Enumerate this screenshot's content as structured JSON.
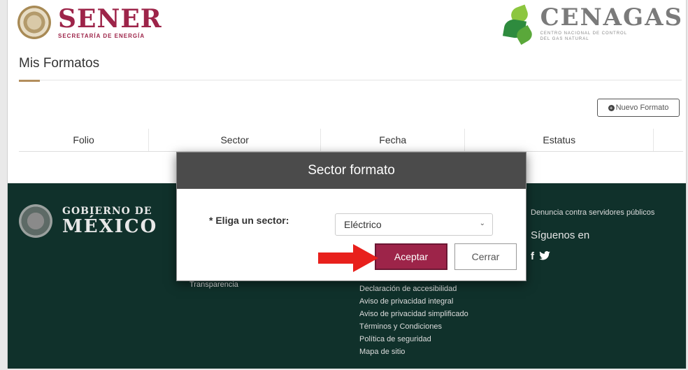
{
  "header": {
    "sener_title": "SENER",
    "sener_subtitle": "SECRETARÍA DE ENERGÍA",
    "cenagas_title": "CENAGAS",
    "cenagas_sub1": "CENTRO NACIONAL DE CONTROL",
    "cenagas_sub2": "DEL GAS NATURAL"
  },
  "page": {
    "title": "Mis Formatos",
    "new_button": "Nuevo Formato",
    "table_headers": [
      "Folio",
      "Sector",
      "Fecha",
      "Estatus",
      ""
    ]
  },
  "footer": {
    "gob_line1": "GOBIERNO DE",
    "gob_line2": "MÉXICO",
    "left_links": [
      "Transparencia"
    ],
    "middle_links": [
      "Declaración de accesibilidad",
      "Aviso de privacidad integral",
      "Aviso de privacidad simplificado",
      "Términos y Condiciones",
      "Política de seguridad",
      "Mapa de sitio"
    ],
    "right_link": "Denuncia contra servidores públicos",
    "follow": "Síguenos en",
    "social_icons": "f 🐦"
  },
  "modal": {
    "title": "Sector formato",
    "label": "* Eliga un sector:",
    "selected": "Eléctrico",
    "accept": "Aceptar",
    "close": "Cerrar"
  },
  "colors": {
    "brand": "#9d2449",
    "footer_bg": "#10312b",
    "modal_header": "#4b4b4b",
    "gold": "#b38e5d",
    "arrow": "#e8201c"
  }
}
